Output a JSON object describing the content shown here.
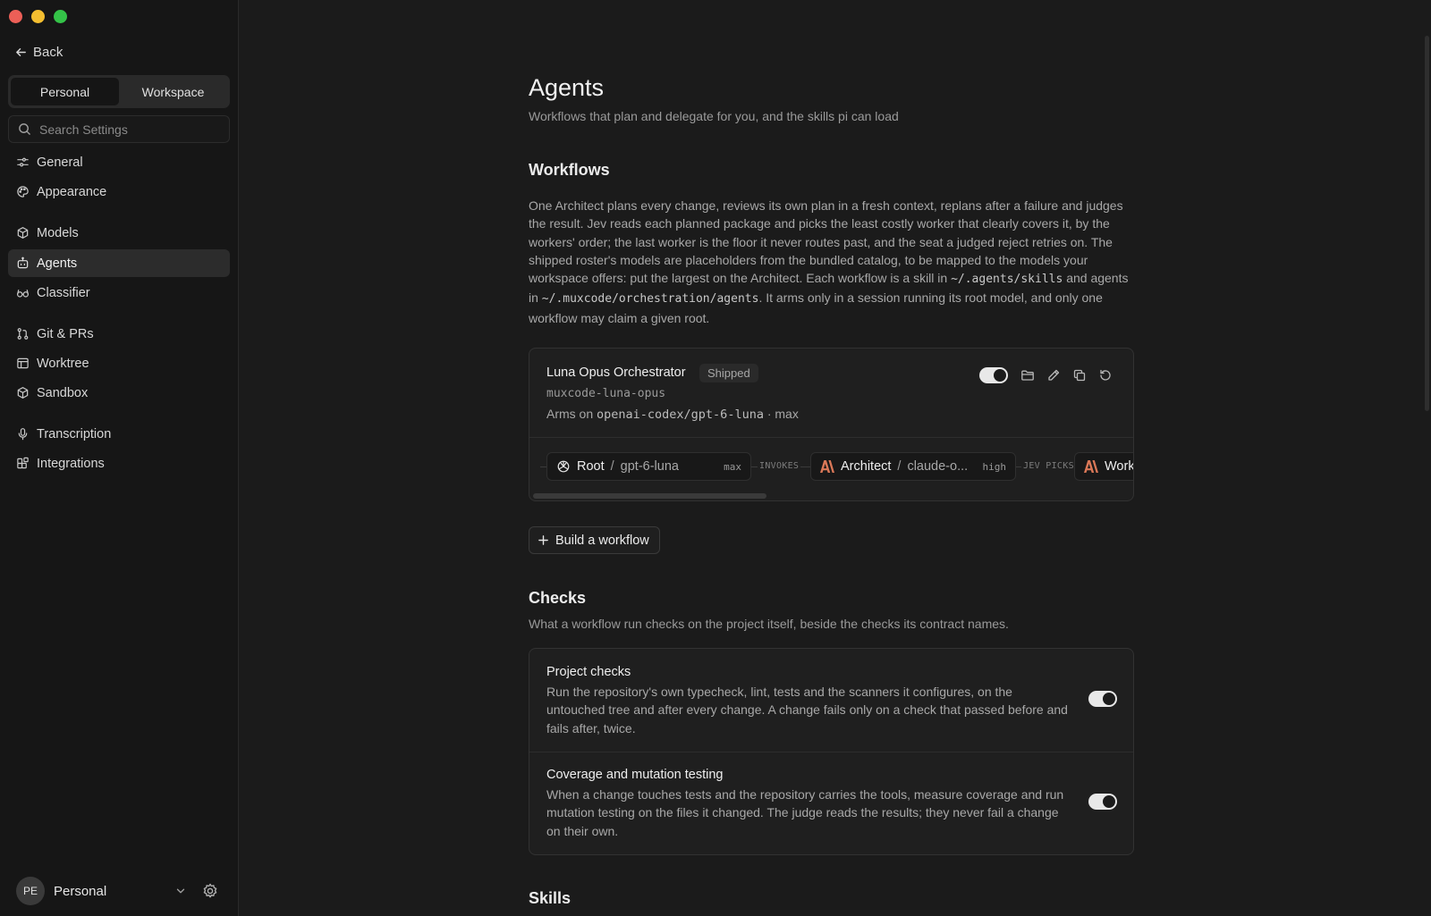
{
  "sidebar": {
    "back_label": "Back",
    "scope_tabs": [
      "Personal",
      "Workspace"
    ],
    "search_placeholder": "Search Settings",
    "items": [
      {
        "label": "General",
        "icon": "sliders-icon"
      },
      {
        "label": "Appearance",
        "icon": "palette-icon"
      },
      {
        "label": "Models",
        "icon": "cube-icon"
      },
      {
        "label": "Agents",
        "icon": "robot-icon"
      },
      {
        "label": "Classifier",
        "icon": "glasses-icon"
      },
      {
        "label": "Git & PRs",
        "icon": "git-pull-request-icon"
      },
      {
        "label": "Worktree",
        "icon": "worktree-icon"
      },
      {
        "label": "Sandbox",
        "icon": "box-icon"
      },
      {
        "label": "Transcription",
        "icon": "microphone-icon"
      },
      {
        "label": "Integrations",
        "icon": "blocks-icon"
      }
    ],
    "user": {
      "initials": "PE",
      "name": "Personal"
    }
  },
  "page": {
    "title": "Agents",
    "subtitle": "Workflows that plan and delegate for you, and the skills pi can load"
  },
  "workflows": {
    "heading": "Workflows",
    "description_parts": [
      "One Architect plans every change, reviews its own plan in a fresh context, replans after a failure and judges the result. Jev reads each planned package and picks the least costly worker that clearly covers it, by the workers' order; the last worker is the floor it never routes past, and the seat a judged reject retries on. The shipped roster's models are placeholders from the bundled catalog, to be mapped to the models your workspace offers: put the largest on the Architect. Each workflow is a skill in ",
      "~/.agents/skills",
      " and agents in ",
      "~/.muxcode/orchestration/agents",
      ". It arms only in a session running its root model, and only one workflow may claim a given root."
    ],
    "card": {
      "name": "Luna Opus Orchestrator",
      "badge": "Shipped",
      "id": "muxcode-luna-opus",
      "arms_prefix": "Arms on",
      "arms_model": "openai-codex/gpt-6-luna",
      "arms_suffix": "· max",
      "enabled": true,
      "pipeline": {
        "nodes": [
          {
            "role": "Root",
            "model": "gpt-6-luna",
            "effort": "max",
            "icon": "openai-icon"
          },
          {
            "role": "Architect",
            "model": "claude-o...",
            "effort": "high",
            "icon": "anthropic-icon"
          },
          {
            "role": "Work",
            "model": "",
            "effort": "",
            "icon": "anthropic-icon"
          }
        ],
        "edges": [
          "INVOKES",
          "JEV PICKS"
        ]
      }
    },
    "build_button": "Build a workflow"
  },
  "checks": {
    "heading": "Checks",
    "subtitle": "What a workflow run checks on the project itself, beside the checks its contract names.",
    "items": [
      {
        "title": "Project checks",
        "description": "Run the repository's own typecheck, lint, tests and the scanners it configures, on the untouched tree and after every change. A change fails only on a check that passed before and fails after, twice.",
        "enabled": true
      },
      {
        "title": "Coverage and mutation testing",
        "description": "When a change touches tests and the repository carries the tools, measure coverage and run mutation testing on the files it changed. The judge reads the results; they never fail a change on their own.",
        "enabled": true
      }
    ]
  },
  "skills": {
    "heading": "Skills"
  },
  "colors": {
    "close": "#ec5f57",
    "minimize": "#f4be30",
    "zoom": "#34c348",
    "anthropic": "#d97757"
  }
}
